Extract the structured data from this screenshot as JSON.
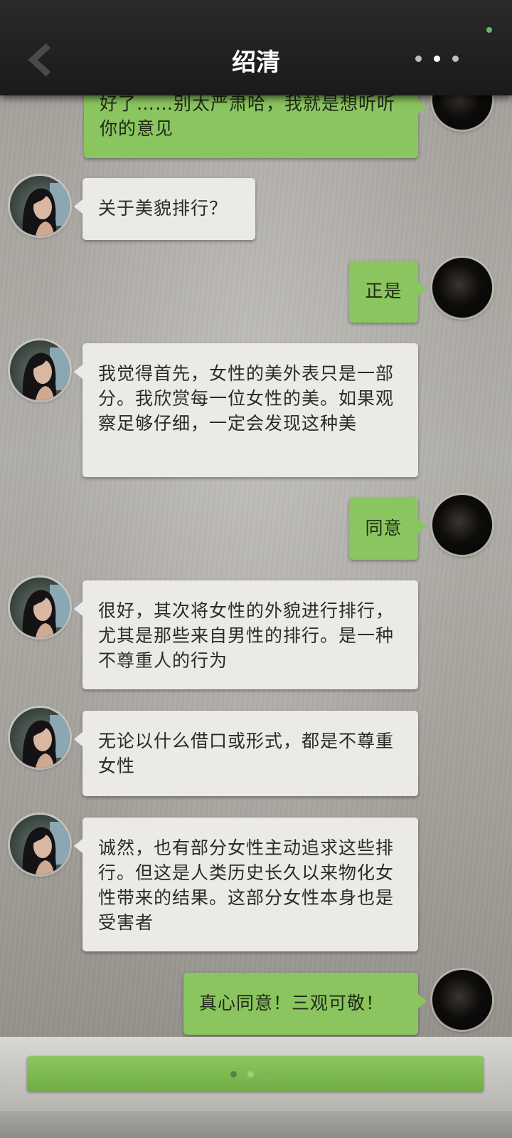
{
  "header": {
    "title": "绍清",
    "back_icon": "chevron-left-icon",
    "more_icon": "more-dots-icon"
  },
  "messages": [
    {
      "side": "right",
      "text": "好了……别太严肃哈，我就是想听听你的意见"
    },
    {
      "side": "left",
      "text": "关于美貌排行？"
    },
    {
      "side": "right",
      "text": "正是"
    },
    {
      "side": "left",
      "text": "我觉得首先，女性的美外表只是一部分。我欣赏每一位女性的美。如果观察足够仔细，一定会发现这种美"
    },
    {
      "side": "right",
      "text": "同意"
    },
    {
      "side": "left",
      "text": "很好，其次将女性的外貌进行排行，尤其是那些来自男性的排行。是一种不尊重人的行为"
    },
    {
      "side": "left",
      "text": "无论以什么借口或形式，都是不尊重女性"
    },
    {
      "side": "left",
      "text": "诚然，也有部分女性主动追求这些排行。但这是人类历史长久以来物化女性带来的结果。这部分女性本身也是受害者"
    },
    {
      "side": "right",
      "text": "真心同意！三观可敬！"
    }
  ],
  "input": {
    "icon": "typing-dots-icon"
  },
  "colors": {
    "topbar": "#1e1e1e",
    "bubble_in": "#ebeae7",
    "bubble_out": "#8bc55f",
    "status_dot": "#5ec15e"
  }
}
